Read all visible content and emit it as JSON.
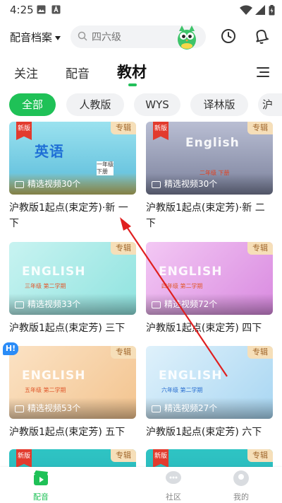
{
  "status": {
    "time": "4:25"
  },
  "topbar": {
    "archive_label": "配音档案",
    "search_placeholder": "四六级"
  },
  "tabs": [
    {
      "label": "关注"
    },
    {
      "label": "配音"
    },
    {
      "label": "教材"
    }
  ],
  "filters": [
    {
      "label": "全部"
    },
    {
      "label": "人教版"
    },
    {
      "label": "WYS"
    },
    {
      "label": "译林版"
    },
    {
      "label": "沪"
    }
  ],
  "cards": [
    {
      "title": "沪教版1起点(束定芳)·新 一下",
      "count": "精选视频30个",
      "badge": "专辑",
      "new": "新版",
      "word": "英语",
      "grade": "一年级 下册"
    },
    {
      "title": "沪教版1起点(束定芳)·新 二下",
      "count": "精选视频30个",
      "badge": "专辑",
      "new": "新版",
      "word": "English",
      "grade": "二年级 下册"
    },
    {
      "title": "沪教版1起点(束定芳) 三下",
      "count": "精选视频33个",
      "badge": "专辑",
      "word": "ENGLISH",
      "grade": "三年级 第二学期"
    },
    {
      "title": "沪教版1起点(束定芳) 四下",
      "count": "精选视频72个",
      "badge": "专辑",
      "word": "ENGLISH",
      "grade": "四年级 第二学期"
    },
    {
      "title": "沪教版1起点(束定芳) 五下",
      "count": "精选视频53个",
      "badge": "专辑",
      "word": "ENGLISH",
      "grade": "五年级 第二学期"
    },
    {
      "title": "沪教版1起点(束定芳) 六下",
      "count": "精选视频27个",
      "badge": "专辑",
      "word": "ENGLISH",
      "grade": "六年级 第二学期"
    },
    {
      "badge": "专辑",
      "new": "新版"
    },
    {
      "badge": "专辑",
      "new": "新版"
    }
  ],
  "floating_badge": "H!",
  "bottom_nav": [
    {
      "label": "配音"
    },
    {
      "label": "社区"
    },
    {
      "label": "我的"
    }
  ],
  "colors": {
    "accent": "#1fc157",
    "badge_bg": "#f6dfb9",
    "annotation_arrow": "#e02020"
  }
}
